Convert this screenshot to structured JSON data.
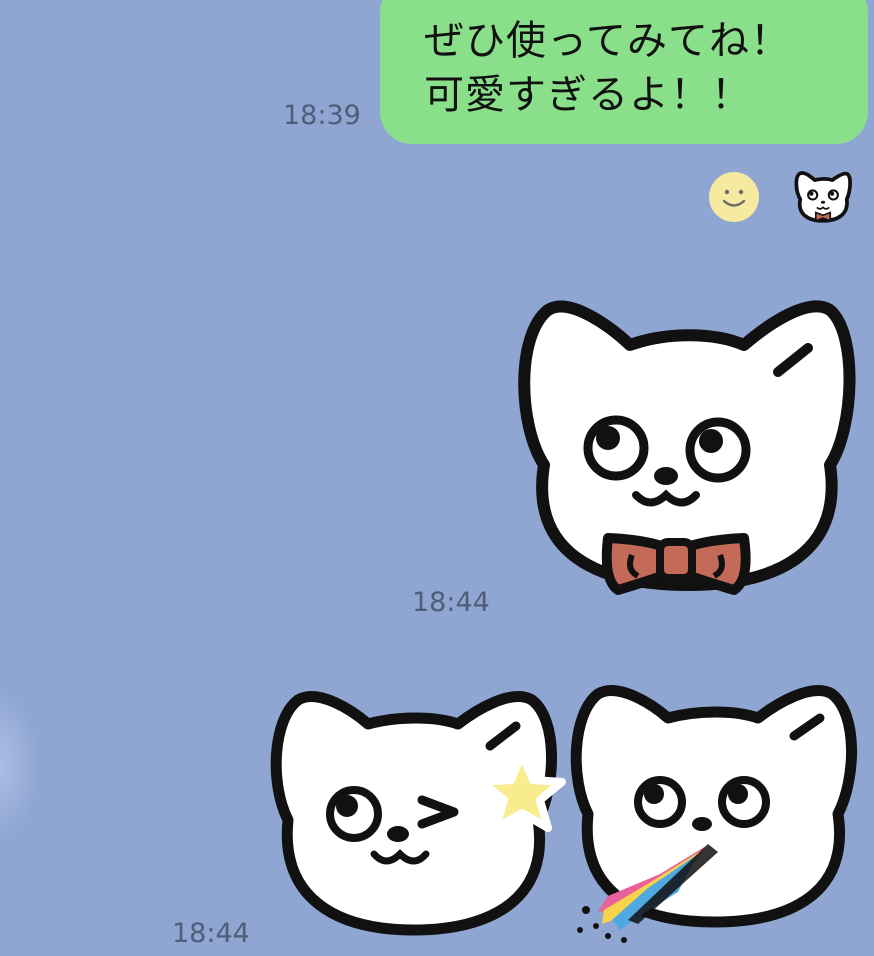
{
  "message": {
    "lines": [
      "ぜひ使ってみてね！",
      "可愛すぎるよ！！"
    ],
    "time": "18:39"
  },
  "reactions": [
    {
      "icon": "smiley-face-icon"
    },
    {
      "icon": "cat-sticker-icon"
    }
  ],
  "stickers": [
    {
      "name": "cat-bowtie-sticker",
      "time": "18:44"
    },
    {
      "name": "cat-wink-star-sticker",
      "time": "18:44"
    },
    {
      "name": "cat-rainbow-sticker"
    }
  ],
  "colors": {
    "background": "#8fa6d3",
    "bubble": "#8ae08a",
    "time_text": "#4f5d77",
    "bowtie": "#c46a58",
    "star": "#f8ec8e"
  }
}
